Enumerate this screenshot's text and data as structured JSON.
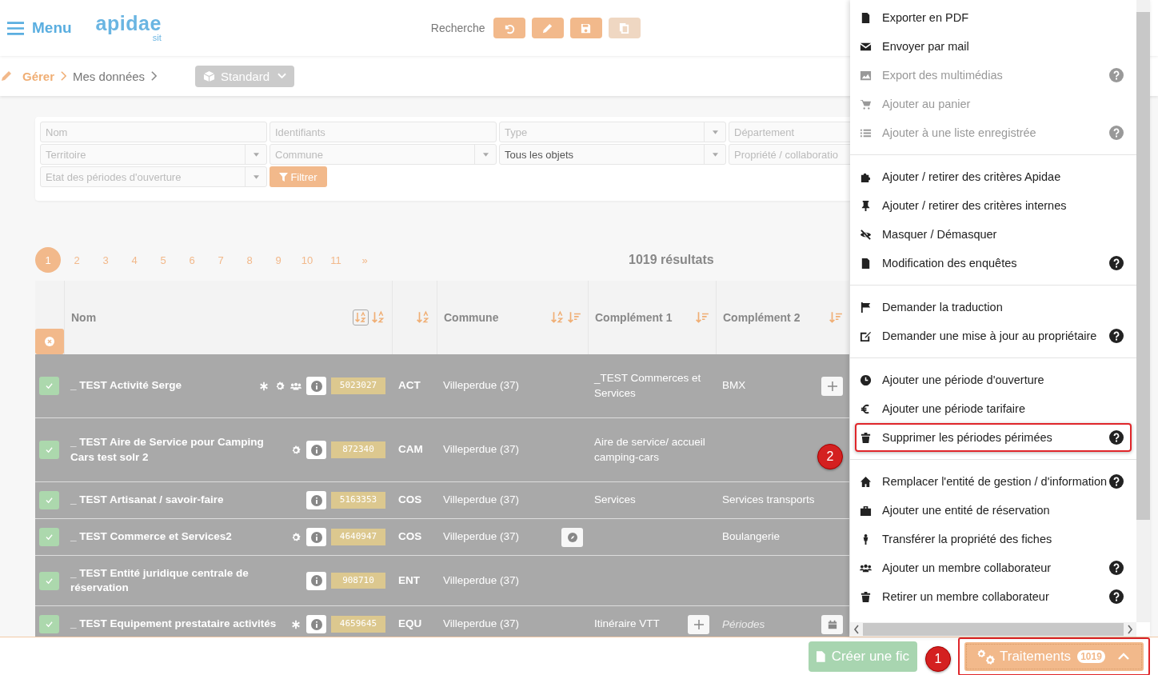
{
  "header": {
    "menu_label": "Menu",
    "logo": {
      "name": "apidae",
      "sub": "sit"
    },
    "search_label": "Recherche",
    "toolbar": [
      {
        "kind": "undo",
        "disabled": false
      },
      {
        "kind": "edit",
        "disabled": false
      },
      {
        "kind": "save",
        "disabled": false
      },
      {
        "kind": "copy",
        "disabled": true
      }
    ]
  },
  "breadcrumb": {
    "items": [
      "Gérer",
      "Mes données"
    ],
    "view": "Standard"
  },
  "filters": {
    "fields": [
      {
        "placeholder": "Nom",
        "kind": "text"
      },
      {
        "placeholder": "Identifiants",
        "kind": "text"
      },
      {
        "placeholder": "Type",
        "kind": "select"
      },
      {
        "placeholder": "Département",
        "kind": "text"
      },
      {
        "placeholder": "Territoire",
        "kind": "select"
      },
      {
        "placeholder": "Commune",
        "kind": "select"
      },
      {
        "value": "Tous les objets",
        "kind": "select"
      },
      {
        "placeholder": "Propriété / collaboratio",
        "kind": "text"
      },
      {
        "placeholder": "Etat des périodes d'ouverture",
        "kind": "select"
      }
    ],
    "button": "Filtrer"
  },
  "pagination": {
    "pages": [
      {
        "label": "1",
        "selected": true
      },
      {
        "label": "2",
        "selected": false
      },
      {
        "label": "3",
        "selected": false
      },
      {
        "label": "4",
        "selected": false
      },
      {
        "label": "5",
        "selected": false
      },
      {
        "label": "6",
        "selected": false
      },
      {
        "label": "7",
        "selected": false
      },
      {
        "label": "8",
        "selected": false
      },
      {
        "label": "9",
        "selected": false
      },
      {
        "label": "10",
        "selected": false
      },
      {
        "label": "11",
        "selected": false
      },
      {
        "label": "»",
        "selected": false
      }
    ],
    "results": "1019 résultats"
  },
  "table": {
    "columns": [
      {
        "label": "Nom"
      },
      {},
      {
        "label": "Commune"
      },
      {
        "label": "Complément 1"
      },
      {
        "label": "Complément 2"
      }
    ],
    "rows": [
      {
        "checked": true,
        "name": "_ TEST Activité Serge",
        "asterisk": true,
        "gear": true,
        "people": true,
        "id": "5023027",
        "type": "ACT",
        "commune": "Villeperdue (37)",
        "complement_1": "_TEST Commerces et Services",
        "complement_2": "BMX",
        "add_button": true
      },
      {
        "checked": true,
        "name": "_ TEST Aire de Service pour Camping Cars test solr 2",
        "gear": true,
        "id": "872340",
        "type": "CAM",
        "commune": "Villeperdue (37)",
        "complement_1": "Aire de service/ accueil camping-cars"
      },
      {
        "checked": true,
        "name": "_ TEST Artisanat / savoir-faire",
        "id": "5163353",
        "type": "COS",
        "commune": "Villeperdue (37)",
        "complement_1": "Services",
        "complement_2": "Services transports"
      },
      {
        "checked": true,
        "name": "_ TEST Commerce et Services2",
        "gear": true,
        "id": "4640947",
        "type": "COS",
        "commune": "Villeperdue (37)",
        "compass_button": true,
        "complement_2": "Boulangerie"
      },
      {
        "checked": true,
        "name": "_ TEST Entité juridique centrale de réservation",
        "id": "908710",
        "type": "ENT",
        "commune": "Villeperdue (37)"
      },
      {
        "checked": true,
        "name": "_ TEST Equipement prestataire activités",
        "asterisk": true,
        "id": "4659645",
        "type": "EQU",
        "commune": "Villeperdue (37)",
        "complement_1": "Itinéraire VTT",
        "complement_1_add_button": true,
        "complement_2_placeholder": "Périodes",
        "calendar_button": true
      }
    ]
  },
  "menu": {
    "groups": [
      [
        {
          "label": "Exporter en PDF",
          "disabled": false,
          "help": false,
          "highlighted": false
        },
        {
          "label": "Envoyer par mail",
          "disabled": false,
          "help": false,
          "highlighted": false
        },
        {
          "label": "Export des multimédias",
          "disabled": true,
          "help": true,
          "highlighted": false
        },
        {
          "label": "Ajouter au panier",
          "disabled": true,
          "help": false,
          "highlighted": false
        },
        {
          "label": "Ajouter à une liste enregistrée",
          "disabled": true,
          "help": true,
          "highlighted": false
        }
      ],
      [
        {
          "label": "Ajouter / retirer des critères Apidae",
          "disabled": false,
          "help": false,
          "highlighted": false
        },
        {
          "label": "Ajouter / retirer des critères internes",
          "disabled": false,
          "help": false,
          "highlighted": false
        },
        {
          "label": "Masquer / Démasquer",
          "disabled": false,
          "help": false,
          "highlighted": false
        },
        {
          "label": "Modification des enquêtes",
          "disabled": false,
          "help": true,
          "highlighted": false
        }
      ],
      [
        {
          "label": "Demander la traduction",
          "disabled": false,
          "help": false,
          "highlighted": false
        },
        {
          "label": "Demander une mise à jour au propriétaire",
          "disabled": false,
          "help": true,
          "highlighted": false
        }
      ],
      [
        {
          "label": "Ajouter une période d'ouverture",
          "disabled": false,
          "help": false,
          "highlighted": false
        },
        {
          "label": "Ajouter une période tarifaire",
          "disabled": false,
          "help": false,
          "highlighted": false
        },
        {
          "label": "Supprimer les périodes périmées",
          "disabled": false,
          "help": true,
          "highlighted": true
        }
      ],
      [
        {
          "label": "Remplacer l'entité de gestion / d'information",
          "disabled": false,
          "help": true,
          "highlighted": false
        },
        {
          "label": "Ajouter une entité de réservation",
          "disabled": false,
          "help": false,
          "highlighted": false
        },
        {
          "label": "Transférer la propriété des fiches",
          "disabled": false,
          "help": false,
          "highlighted": false
        },
        {
          "label": "Ajouter un membre collaborateur",
          "disabled": false,
          "help": true,
          "highlighted": false
        },
        {
          "label": "Retirer un membre collaborateur",
          "disabled": false,
          "help": true,
          "highlighted": false
        }
      ]
    ]
  },
  "footer": {
    "create_button": "Créer une fic",
    "process_button": {
      "label": "Traitements",
      "count": "1019",
      "highlighted": true
    }
  },
  "callouts": [
    {
      "label": "1"
    },
    {
      "label": "2"
    }
  ]
}
